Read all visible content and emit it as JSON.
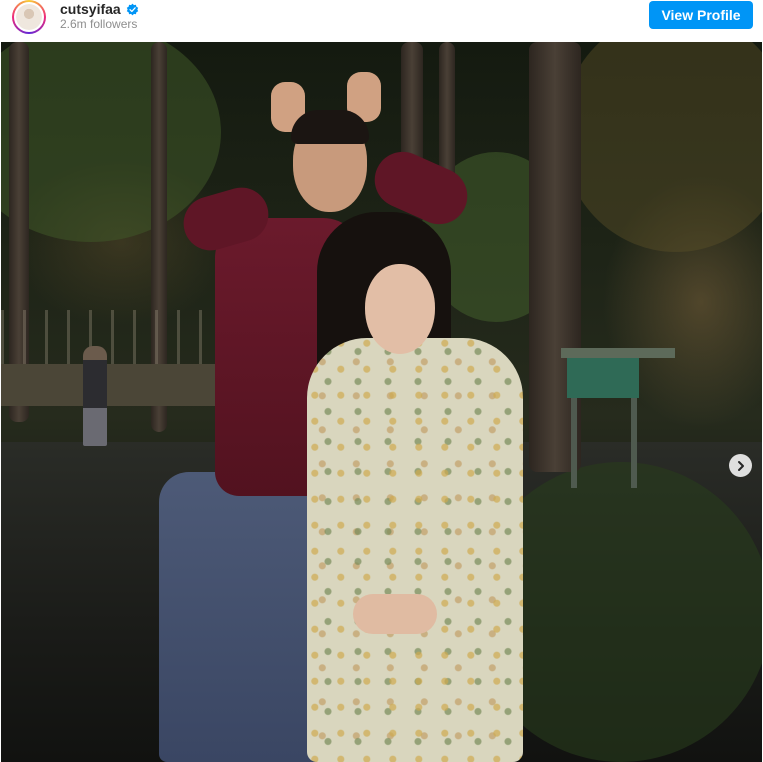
{
  "header": {
    "username": "cutsyifaa",
    "verified_icon": "verified-badge-icon",
    "followers": "2.6m followers",
    "view_profile_label": "View Profile",
    "accent_color": "#0095f6"
  },
  "post": {
    "carousel_next_icon": "chevron-right-icon"
  }
}
